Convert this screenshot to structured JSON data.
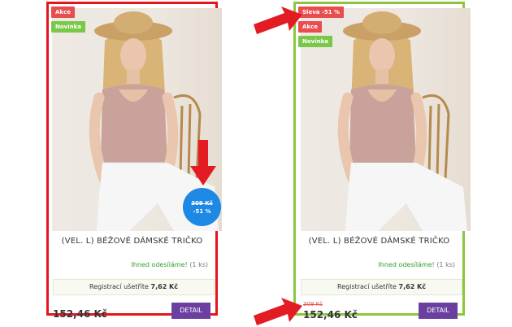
{
  "colors": {
    "left_border": "#e8141c",
    "right_border": "#8cc63f",
    "badge_red": "#e84d4f",
    "badge_green": "#79c84a",
    "discount_circle": "#1e88e5",
    "detail_button": "#6b3fa0",
    "stock_green": "#2e9e2a",
    "arrow_red": "#e31b23"
  },
  "left_card": {
    "badges": [
      "Akce",
      "Novinka"
    ],
    "discount_circle": {
      "old_price": "309 Kč",
      "percent": "-51 %"
    },
    "title": "(VEL. L) BÉŽOVÉ DÁMSKÉ TRIČKO",
    "stock_text": "Ihned odesíláme!",
    "stock_qty": "(1 ks)",
    "save_label": "Registrací ušetříte",
    "save_amount": "7,62 Kč",
    "price": "152,46 Kč",
    "detail_label": "DETAIL"
  },
  "right_card": {
    "badges": [
      "Sleva -51 %",
      "Akce",
      "Novinka"
    ],
    "title": "(VEL. L) BÉŽOVÉ DÁMSKÉ TRIČKO",
    "stock_text": "Ihned odesíláme!",
    "stock_qty": "(1 ks)",
    "save_label": "Registrací ušetříte",
    "save_amount": "7,62 Kč",
    "old_price": "309 Kč",
    "price": "152,46 Kč",
    "detail_label": "DETAIL"
  },
  "icons": [
    "arrow-down-icon",
    "arrow-right-icon",
    "product-photo"
  ]
}
